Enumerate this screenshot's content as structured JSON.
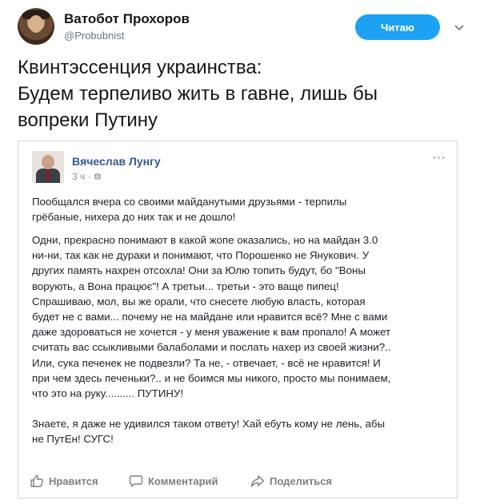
{
  "tweet": {
    "author_name": "Ватобот Прохоров",
    "author_handle": "@Probubnist",
    "follow_label": "Читаю",
    "text_lines": [
      "Квинтэссенция украинства:",
      "Будем терпеливо жить в гавне, лишь бы",
      "вопреки Путину"
    ]
  },
  "fb_post": {
    "author": "Вячеслав Лунгу",
    "time": "3 ч ·",
    "more": "···",
    "paragraphs": [
      [
        "Пообщался вчера со своими майданутыми друзьями - терпилы",
        "грёбаные, нихера до них так и не дошло!"
      ],
      [
        "Одни, прекрасно понимают в какой жопе оказались, но на майдан 3.0",
        "ни-ни, так как не дураки и понимают, что Порошенко не Янукович. У",
        "других память нахрен отсохла! Они за Юлю топить будут, бо \"Воны",
        "ворують, а Вона працює\"! А третьи... третьи - это ваще пипец!",
        "Спрашиваю, мол, вы же орали, что снесете любую власть, которая",
        "будет не с вами... почему не на майдане или нравится всё? Мне с вами",
        "даже здороваться не хочется - у меня уважение к вам пропало! А может",
        "считать вас ссыкливыми балаболами и послать нахер из своей жизни?..",
        "Или, сука печенек не подвезли? Та не, - отвечает, - всё не нравится! И",
        "при чем здесь печеньки?.. и не боимся мы никого, просто мы понимаем,",
        "что это на руку.......... ПУТИНУ!"
      ],
      [
        "Знаете, я даже не удивился таком ответу! Хай ебуть кому не лень, абы",
        "не ПутЕн! СУГС!"
      ]
    ],
    "actions": {
      "like": "Нравится",
      "comment": "Комментарий",
      "share": "Поделиться"
    }
  },
  "colors": {
    "follow_button": "#1da1f2",
    "fb_link": "#365899",
    "muted": "#90949c"
  },
  "icons": [
    "chevron-down-icon",
    "globe-icon",
    "more-icon",
    "like-icon",
    "comment-icon",
    "share-icon"
  ]
}
